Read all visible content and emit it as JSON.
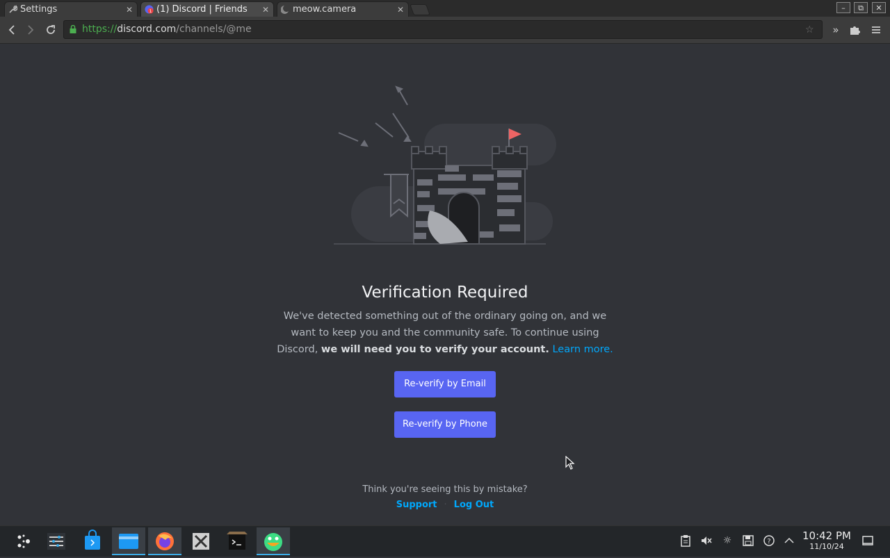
{
  "browser": {
    "tabs": [
      {
        "title": "Settings",
        "icon": "wrench-icon"
      },
      {
        "title": "(1) Discord | Friends",
        "icon": "discord-icon",
        "badge": "1"
      },
      {
        "title": "meow.camera",
        "icon": "moon-icon"
      }
    ],
    "url": {
      "scheme": "https://",
      "host": "discord.com",
      "path": "/channels/@me"
    }
  },
  "page": {
    "title": "Verification Required",
    "desc_plain": "We've detected something out of the ordinary going on, and we want to keep you and the community safe. To continue using Discord, ",
    "desc_bold": "we will need you to verify your account.",
    "learn_more": "Learn more.",
    "email_button": "Re-verify by Email",
    "phone_button": "Re-verify by Phone",
    "mistake_text": "Think you're seeing this by mistake?",
    "support_link": "Support",
    "logout_link": "Log Out"
  },
  "colors": {
    "accent": "#5865f2",
    "link": "#00a8fc",
    "background": "#313338"
  },
  "taskbar": {
    "apps": [
      "launcher-icon",
      "settings-sliders-icon",
      "store-icon",
      "file-manager-icon",
      "firefox-icon",
      "x-app-icon",
      "terminal-icon",
      "android-icon"
    ],
    "time": "10:42 PM",
    "date": "11/10/24"
  }
}
